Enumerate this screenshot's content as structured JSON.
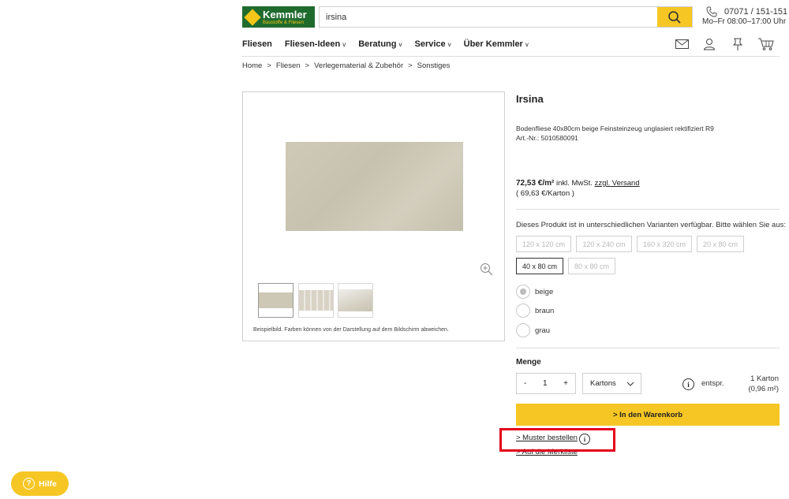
{
  "header": {
    "logo_name": "Kemmler",
    "logo_sub": "Baustoffe & Fliesen",
    "search_value": "irsina",
    "phone": "07071 / 151-151",
    "hours": "Mo–Fr 08:00–17:00 Uhr"
  },
  "nav": [
    {
      "label": "Fliesen",
      "chevron": ""
    },
    {
      "label": "Fliesen-Ideen",
      "chevron": "v"
    },
    {
      "label": "Beratung",
      "chevron": "v"
    },
    {
      "label": "Service",
      "chevron": "v"
    },
    {
      "label": "Über Kemmler",
      "chevron": "v"
    }
  ],
  "breadcrumb": {
    "items": [
      "Home",
      "Fliesen",
      "Verlegematerial & Zubehör",
      "Sonstiges"
    ],
    "separator": ">"
  },
  "gallery": {
    "disclaimer": "Beispielbild. Farben können von der Darstellung auf dem Bildschirm abweichen."
  },
  "product": {
    "title": "Irsina",
    "description": "Bodenfliese 40x80cm beige Feinsteinzeug unglasiert rektifiziert R9",
    "article_no": "Art.-Nr.: 5010580091",
    "price": "72,53 €/m²",
    "price_tax": "inkl. MwSt.",
    "shipping_link": "zzgl. Versand",
    "price_carton": "( 69,63 €/Karton )",
    "variant_hint": "Dieses Produkt ist in unterschiedlichen Varianten verfügbar. Bitte wählen Sie aus:",
    "sizes": [
      "120 x 120 cm",
      "120 x 240 cm",
      "160 x 320 cm",
      "20 x 80 cm",
      "40 x 80 cm",
      "80 x 80 cm"
    ],
    "selected_size": "40 x 80 cm",
    "colors": [
      "beige",
      "braun",
      "grau"
    ],
    "selected_color": "beige"
  },
  "quantity": {
    "label": "Menge",
    "minus": "-",
    "value": "1",
    "plus": "+",
    "unit": "Kartons",
    "info": "i",
    "equivalent_label": "entspr.",
    "equivalent_line1": "1 Karton",
    "equivalent_line2": "(0,96 m²)"
  },
  "actions": {
    "cart": "> In den Warenkorb",
    "sample": "> Muster bestellen",
    "wishlist": "> Auf die Merkliste"
  },
  "help": {
    "label": "Hilfe",
    "icon_text": "?"
  },
  "colors": {
    "accent": "#f6c624",
    "brand_green": "#1f6b2e",
    "highlight": "#e3001b"
  }
}
